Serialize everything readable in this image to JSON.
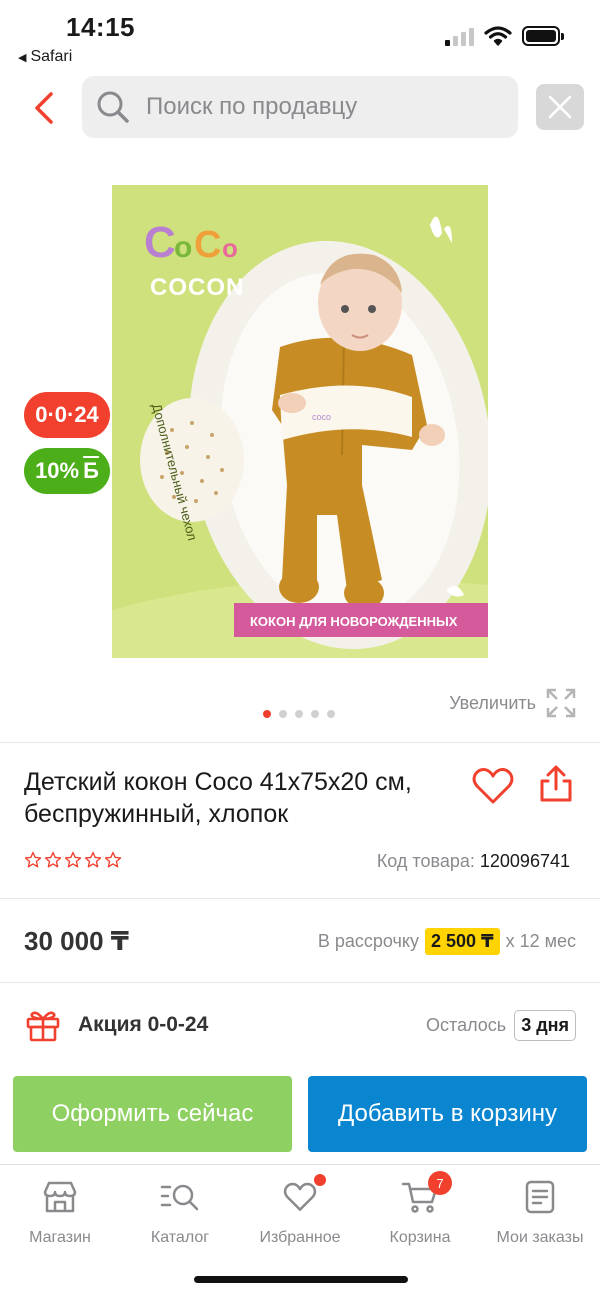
{
  "status_bar": {
    "time": "14:15",
    "back_app": "Safari"
  },
  "search": {
    "placeholder": "Поиск по продавцу"
  },
  "gallery": {
    "image_text": {
      "brand_logo": "CoCo",
      "brand_name": "COCON",
      "side_text": "Дополнительный чехол",
      "caption": "КОКОН ДЛЯ НОВОРОЖДЕННЫХ"
    },
    "badge_promo": "0·0·24",
    "badge_bonus": "10%",
    "badge_bonus_unit": "Б",
    "zoom_label": "Увеличить",
    "dots_count": 5,
    "active_dot": 0
  },
  "product": {
    "title": "Детский кокон Coco 41x75x20 см, беспружинный, хлопок",
    "rating": 0,
    "code_label": "Код товара:",
    "code_value": "120096741"
  },
  "price": {
    "value": "30 000 ₸",
    "installment_prefix": "В рассрочку",
    "installment_amount": "2 500 ₸",
    "installment_suffix": "x 12 мес"
  },
  "promo": {
    "label": "Акция 0-0-24",
    "remaining_label": "Осталось",
    "remaining_value": "3 дня"
  },
  "actions": {
    "buy_now": "Оформить сейчас",
    "add_to_cart": "Добавить в корзину"
  },
  "tabbar": {
    "items": [
      {
        "label": "Магазин",
        "icon": "shop-icon"
      },
      {
        "label": "Каталог",
        "icon": "catalog-search-icon"
      },
      {
        "label": "Избранное",
        "icon": "heart-icon"
      },
      {
        "label": "Корзина",
        "icon": "cart-icon"
      },
      {
        "label": "Мои заказы",
        "icon": "orders-icon"
      }
    ],
    "cart_count": "7"
  },
  "colors": {
    "accent_red": "#f1402e",
    "buy_green": "#8ed061",
    "cart_blue": "#0a86d1",
    "bonus_green": "#4caf1a",
    "highlight_yellow": "#ffd400"
  }
}
